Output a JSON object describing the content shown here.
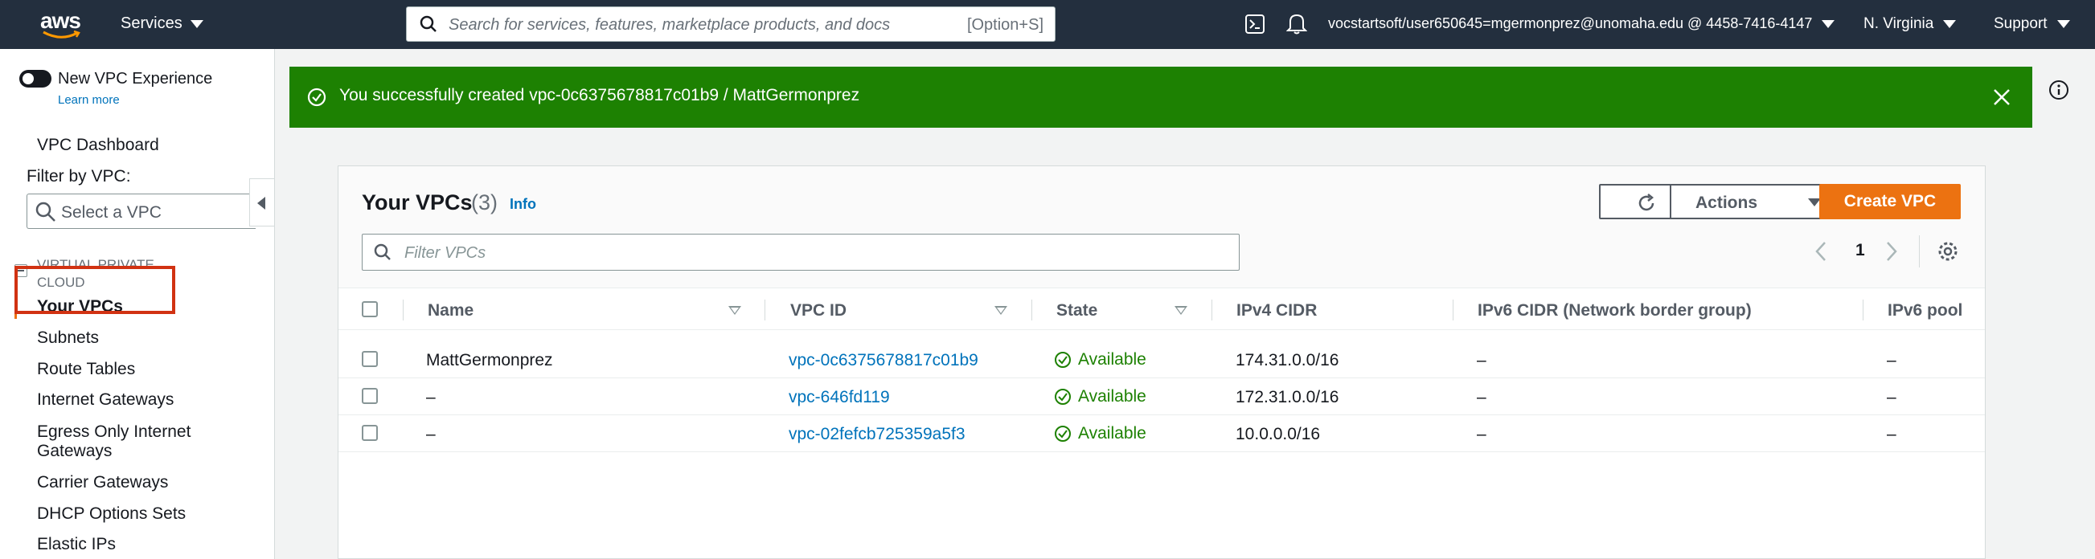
{
  "topnav": {
    "logo_text": "aws",
    "services_label": "Services",
    "search_placeholder": "Search for services, features, marketplace products, and docs",
    "search_shortcut": "[Option+S]",
    "account": "vocstartsoft/user650645=mgermonprez@unomaha.edu @ 4458-7416-4147",
    "region": "N. Virginia",
    "support": "Support"
  },
  "sidebar": {
    "toggle_label": "New VPC Experience",
    "learn_more": "Learn more",
    "dashboard": "VPC Dashboard",
    "filter_label": "Filter by VPC:",
    "filter_placeholder": "Select a VPC",
    "section_title": "VIRTUAL PRIVATE CLOUD",
    "items": [
      {
        "label": "Your VPCs"
      },
      {
        "label": "Subnets"
      },
      {
        "label": "Route Tables"
      },
      {
        "label": "Internet Gateways"
      },
      {
        "label": "Egress Only Internet Gateways"
      },
      {
        "label": "Carrier Gateways"
      },
      {
        "label": "DHCP Options Sets"
      },
      {
        "label": "Elastic IPs"
      }
    ]
  },
  "flash": {
    "message": "You successfully created vpc-0c6375678817c01b9 / MattGermonprez"
  },
  "panel": {
    "title": "Your VPCs",
    "count": "(3)",
    "info": "Info",
    "actions_label": "Actions",
    "create_label": "Create VPC",
    "filter_placeholder": "Filter VPCs",
    "page": "1"
  },
  "table": {
    "columns": [
      "Name",
      "VPC ID",
      "State",
      "IPv4 CIDR",
      "IPv6 CIDR (Network border group)",
      "IPv6 pool"
    ],
    "rows": [
      {
        "name": "MattGermonprez",
        "vpc_id": "vpc-0c6375678817c01b9",
        "state": "Available",
        "ipv4": "174.31.0.0/16",
        "ipv6": "–",
        "pool": "–"
      },
      {
        "name": "–",
        "vpc_id": "vpc-646fd119",
        "state": "Available",
        "ipv4": "172.31.0.0/16",
        "ipv6": "–",
        "pool": "–"
      },
      {
        "name": "–",
        "vpc_id": "vpc-02fefcb725359a5f3",
        "state": "Available",
        "ipv4": "10.0.0.0/16",
        "ipv6": "–",
        "pool": "–"
      }
    ]
  },
  "colors": {
    "nav_bg": "#232f3e",
    "success": "#1d8102",
    "primary": "#ec7211",
    "link": "#0073bb",
    "highlight": "#d13212"
  }
}
